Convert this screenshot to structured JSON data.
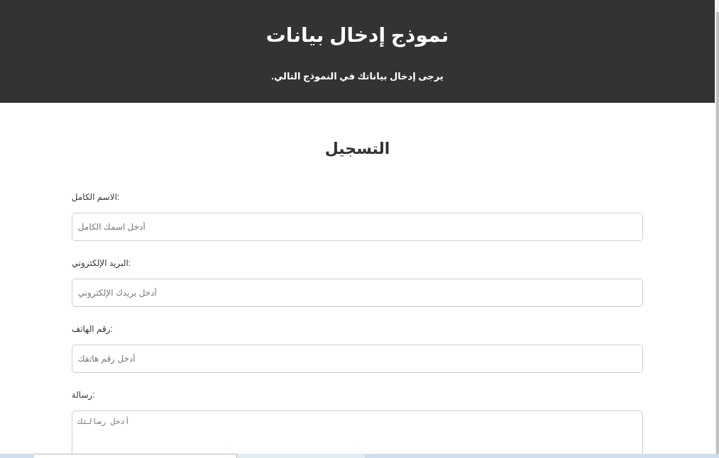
{
  "header": {
    "title": "نموذج إدخال بيانات",
    "subtitle": "يرجى إدخال بياناتك في النموذج التالي."
  },
  "form": {
    "title": "التسجيل",
    "fields": [
      {
        "kind": "text",
        "label": "الاسم الكامل:",
        "placeholder": "أدخل اسمك الكامل"
      },
      {
        "kind": "text",
        "label": "البريد الإلكتروني:",
        "placeholder": "أدخل بريدك الإلكتروني"
      },
      {
        "kind": "text",
        "label": "رقم الهاتف:",
        "placeholder": "أدخل رقم هاتفك"
      },
      {
        "kind": "textarea",
        "label": "رسالة:",
        "placeholder": "أدخل رسالتك"
      }
    ]
  }
}
